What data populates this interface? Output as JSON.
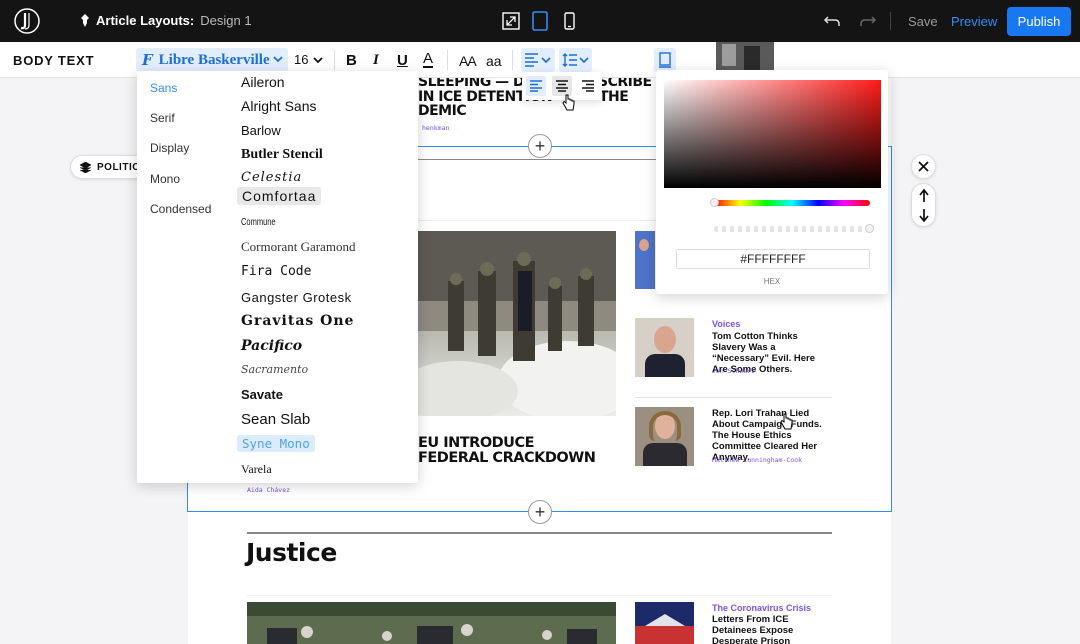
{
  "topbar": {
    "crumb_label": "Article Layouts:",
    "crumb_value": "Design 1",
    "save": "Save",
    "preview": "Preview",
    "publish": "Publish"
  },
  "toolbar": {
    "section": "BODY TEXT",
    "font_icon": "F",
    "font_name": "Libre Baskerville",
    "font_size": "16",
    "bold": "B",
    "italic": "I",
    "underline": "U",
    "color": "A",
    "case_upper": "AA",
    "case_lower": "aa"
  },
  "font_menu": {
    "categories": [
      "Sans",
      "Serif",
      "Display",
      "Mono",
      "Condensed"
    ],
    "fonts": [
      "Aileron",
      "Alright Sans",
      "Barlow",
      "Butler Stencil",
      "Celestia",
      "Comfortaa",
      "Commune",
      "Cormorant Garamond",
      "Fira Code",
      "Gangster Grotesk",
      "Gravitas One",
      "Pacifico",
      "Sacramento",
      "Savate",
      "Sean Slab",
      "Syne Mono",
      "Varela"
    ]
  },
  "picker": {
    "hex": "#FFFFFFFF",
    "hex_label": "HEX"
  },
  "article": {
    "section_tag": "POLITIC",
    "top_headline_l1": "SLEEPING — DET",
    "top_headline_l1b": "SCRIBE",
    "top_headline_l2": "IN ICE DETENTION",
    "top_headline_l2b": "THE",
    "top_headline_l3": "DEMIC",
    "top_byline": "henkman",
    "main_headline_l1": "EU INTRODUCE",
    "main_headline_l2": "FEDERAL CRACKDOWN",
    "main_byline": "Aida Chávez",
    "story2_kicker": "Voices",
    "story2_title": "Tom Cotton Thinks Slavery Was a “Necessary” Evil. Here Are Some Others.",
    "story2_byline": "Jon Schwarz",
    "story3_title": "Rep. Lori Trahan Lied About Campaign Funds. The House Ethics Committee Cleared Her Anyway.",
    "story3_byline": "Matthew Cunningham-Cook",
    "justice": "Justice",
    "story4_kicker": "The Coronavirus Crisis",
    "story4_title": "Letters From ICE Detainees Expose Desperate Prison Conditions Amid"
  },
  "colors": {
    "accent": "#2f8cf5",
    "publish": "#1778f2",
    "topbar": "#141414",
    "kicker": "#7a52e8"
  }
}
